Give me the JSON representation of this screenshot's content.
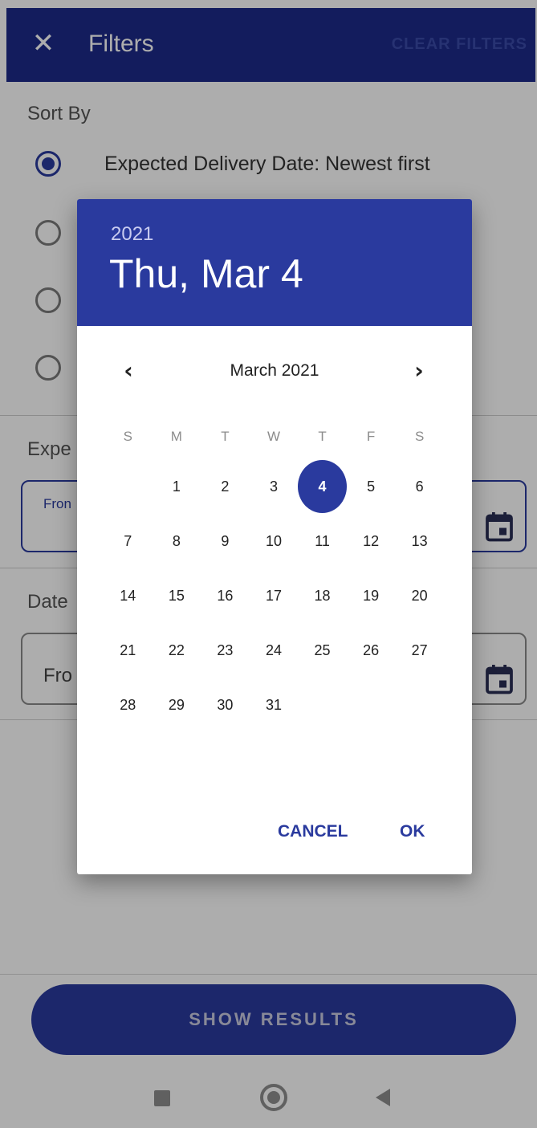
{
  "app_bar": {
    "title": "Filters",
    "close_icon": "close-icon",
    "clear_label": "CLEAR FILTERS"
  },
  "sort": {
    "label": "Sort By",
    "options": [
      {
        "label": "Expected Delivery Date: Newest first",
        "checked": true
      },
      {
        "label": "",
        "checked": false
      },
      {
        "label": "",
        "checked": false
      },
      {
        "label": "",
        "checked": false
      }
    ]
  },
  "expected_section": {
    "label": "Expe",
    "from_placeholder": "Fron"
  },
  "date_section": {
    "label": "Date",
    "from_placeholder": "Fro"
  },
  "show_results_label": "SHOW RESULTS",
  "picker": {
    "year": "2021",
    "selected_date": "Thu, Mar 4",
    "month_label": "March 2021",
    "prev_icon": "chevron-left-icon",
    "next_icon": "chevron-right-icon",
    "weekdays": [
      "S",
      "M",
      "T",
      "W",
      "T",
      "F",
      "S"
    ],
    "weeks": [
      [
        "",
        "1",
        "2",
        "3",
        "4",
        "5",
        "6"
      ],
      [
        "7",
        "8",
        "9",
        "10",
        "11",
        "12",
        "13"
      ],
      [
        "14",
        "15",
        "16",
        "17",
        "18",
        "19",
        "20"
      ],
      [
        "21",
        "22",
        "23",
        "24",
        "25",
        "26",
        "27"
      ],
      [
        "28",
        "29",
        "30",
        "31",
        "",
        "",
        ""
      ]
    ],
    "selected_day": "4",
    "cancel_label": "CANCEL",
    "ok_label": "OK"
  },
  "colors": {
    "app_bar": "#1c2a8a",
    "accent": "#2a3a9e"
  }
}
